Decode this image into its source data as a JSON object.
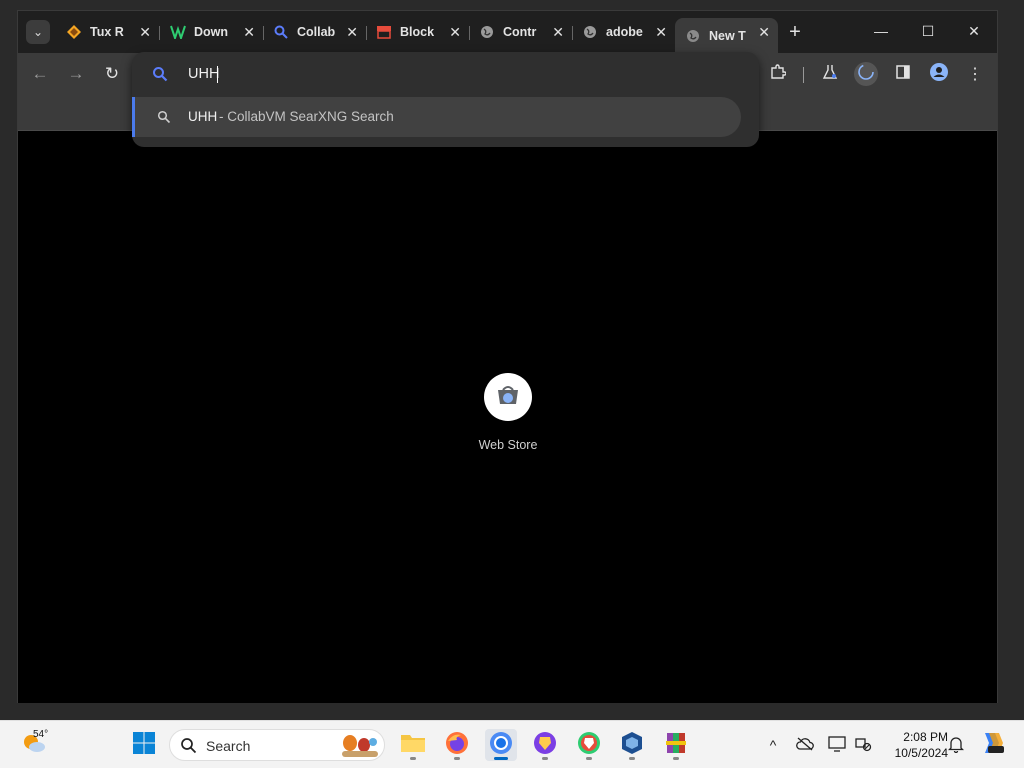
{
  "browser": {
    "tabs": [
      {
        "title": "Tux R",
        "icon": "tux-racer-icon",
        "color": "#f5a623"
      },
      {
        "title": "Down",
        "icon": "vm-icon",
        "color": "#2ecc71"
      },
      {
        "title": "Collab",
        "icon": "search-icon",
        "color": "#5b7cfa"
      },
      {
        "title": "Block",
        "icon": "store-icon",
        "color": "#e74c3c"
      },
      {
        "title": "Contr",
        "icon": "globe-icon",
        "color": "#aaaaaa"
      },
      {
        "title": "adobe",
        "icon": "globe-icon",
        "color": "#aaaaaa"
      },
      {
        "title": "New T",
        "icon": "globe-icon",
        "color": "#aaaaaa"
      }
    ],
    "active_tab_index": 6,
    "omnibox": {
      "value": "UHH",
      "suggestion_query": "UHH",
      "suggestion_desc": "- CollabVM SearXNG Search"
    },
    "shortcut": {
      "label": "Web Store",
      "icon": "web-store-icon"
    }
  },
  "taskbar": {
    "weather_temp": "54°",
    "search_label": "Search",
    "time": "2:08 PM",
    "date": "10/5/2024",
    "apps": [
      "file-explorer-icon",
      "firefox-icon",
      "chromium-icon",
      "brave-nightly-icon",
      "brave-icon",
      "virtualbox-icon",
      "winrar-icon"
    ]
  },
  "colors": {
    "accent": "#4b7bec",
    "taskbar_active": "#0067c0"
  }
}
